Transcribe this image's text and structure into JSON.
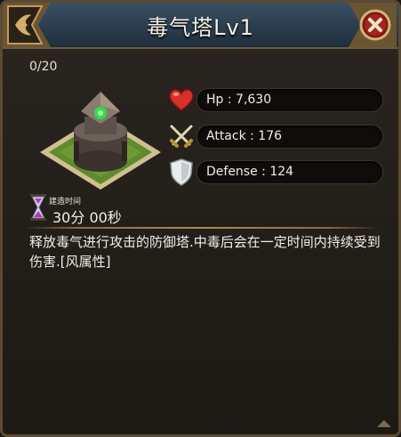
{
  "window": {
    "title": "毒气塔Lv1"
  },
  "building": {
    "count": "0/20",
    "stats": [
      {
        "icon": "heart-icon",
        "label": "Hp : 7,630"
      },
      {
        "icon": "crossed-swords-icon",
        "label": "Attack : 176"
      },
      {
        "icon": "shield-icon",
        "label": "Defense : 124"
      }
    ],
    "build_time_label": "建造时间",
    "build_time_value": "30分 00秒",
    "description": "释放毒气进行攻击的防御塔.中毒后会在一定时间内持续受到伤害.[风属性]"
  },
  "colors": {
    "accent": "#b08a4e",
    "title_bar": "#2c3f52",
    "close_button": "#8e1e16"
  }
}
